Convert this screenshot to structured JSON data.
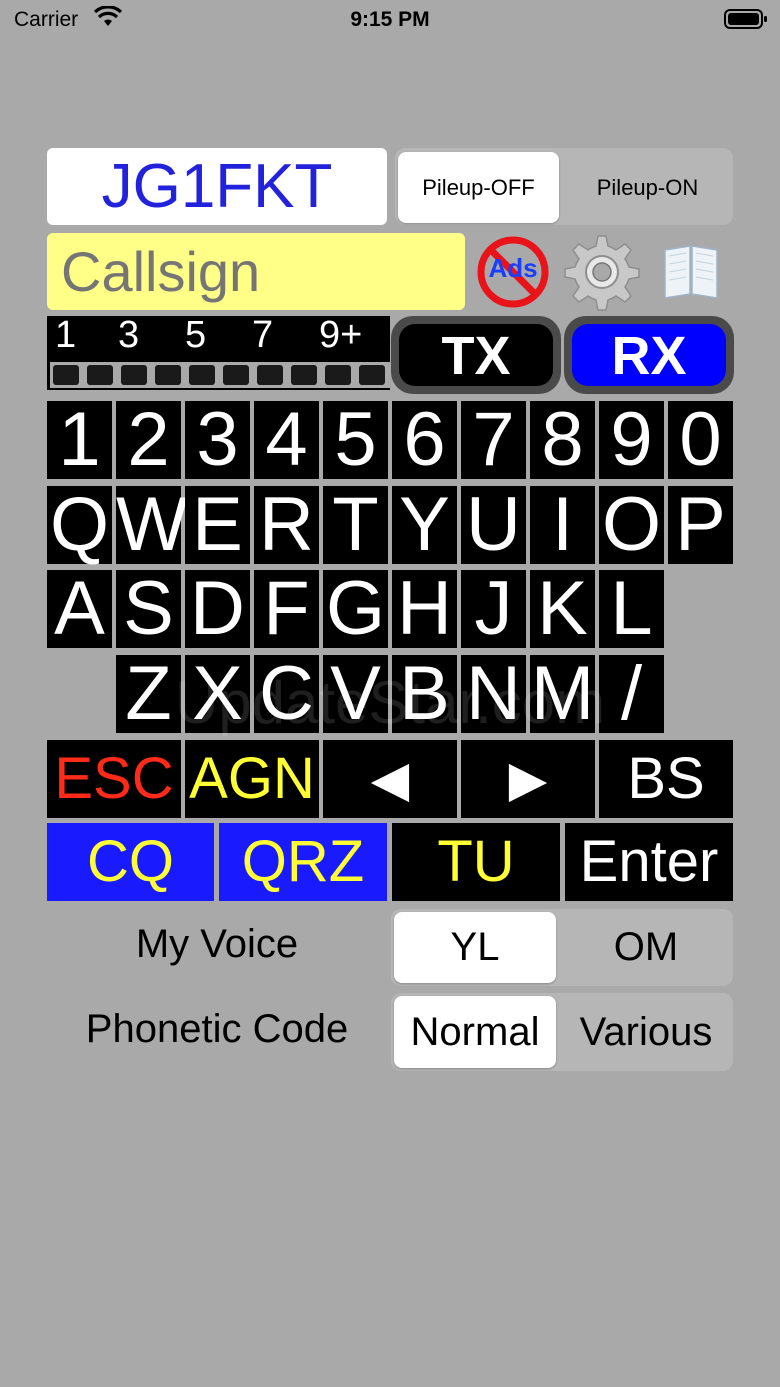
{
  "status_bar": {
    "carrier": "Carrier",
    "time": "9:15 PM"
  },
  "my_callsign": "JG1FKT",
  "pileup": {
    "options": [
      "Pileup-OFF",
      "Pileup-ON"
    ],
    "selected": "Pileup-OFF"
  },
  "callsign_input": {
    "placeholder": "Callsign",
    "value": ""
  },
  "ads_label": "Ads",
  "meter": {
    "labels": [
      "1",
      "3",
      "5",
      "7",
      "9+"
    ],
    "segments": 10
  },
  "tx_label": "TX",
  "rx_label": "RX",
  "keyboard": {
    "row_numbers": [
      "1",
      "2",
      "3",
      "4",
      "5",
      "6",
      "7",
      "8",
      "9",
      "0"
    ],
    "row_q": [
      "Q",
      "W",
      "E",
      "R",
      "T",
      "Y",
      "U",
      "I",
      "O",
      "P"
    ],
    "row_a": [
      "A",
      "S",
      "D",
      "F",
      "G",
      "H",
      "J",
      "K",
      "L"
    ],
    "row_z": [
      "Z",
      "X",
      "C",
      "V",
      "B",
      "N",
      "M",
      "/"
    ]
  },
  "function_keys": {
    "esc": "ESC",
    "agn": "AGN",
    "left": "◀",
    "right": "▶",
    "bs": "BS",
    "cq": "CQ",
    "qrz": "QRZ",
    "tu": "TU",
    "enter": "Enter"
  },
  "my_voice": {
    "label": "My Voice",
    "options": [
      "YL",
      "OM"
    ],
    "selected": "YL"
  },
  "phonetic_code": {
    "label": "Phonetic Code",
    "options": [
      "Normal",
      "Various"
    ],
    "selected": "Normal"
  },
  "watermark": "UpdateStar.com",
  "colors": {
    "background": "#a9a9a9",
    "my_call_text": "#2222dd",
    "callsign_bg": "#ffff88",
    "esc": "#ff2a1a",
    "agn": "#ffff33",
    "cq_bg": "#1a1aff",
    "cq_text": "#ffff33",
    "rx_bg": "#0000ff"
  }
}
